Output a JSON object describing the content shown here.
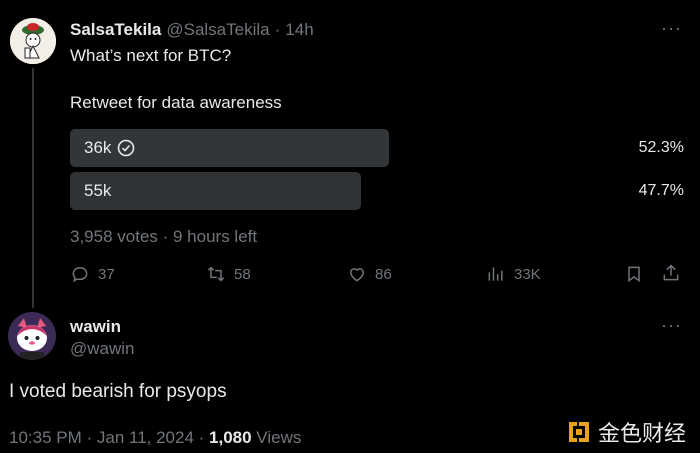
{
  "tweet1": {
    "display_name": "SalsaTekila",
    "handle": "@SalsaTekila",
    "separator": "·",
    "time": "14h",
    "more": "···",
    "text": "What’s next for BTC?",
    "subtext": "Retweet for data awareness",
    "poll": {
      "options": [
        {
          "label": "36k",
          "percent_label": "52.3%",
          "percent": 52.3,
          "winner": true
        },
        {
          "label": "55k",
          "percent_label": "47.7%",
          "percent": 47.7,
          "winner": false
        }
      ],
      "summary": "3,958 votes · 9 hours left"
    },
    "actions": {
      "replies": "37",
      "retweets": "58",
      "likes": "86",
      "views": "33K"
    }
  },
  "tweet2": {
    "display_name": "wawin",
    "handle": "@wawin",
    "more": "···",
    "text": "I voted bearish for psyops",
    "timestamp": "10:35 PM · Jan 11, 2024 · ",
    "views_count": "1,080",
    "views_label": " Views"
  },
  "watermark": {
    "text": "金色财经"
  },
  "colors": {
    "background": "#000000",
    "winner_bar": "#333639",
    "loser_bar": "#2f3336",
    "muted": "#71767b",
    "text": "#e7e9ea"
  }
}
